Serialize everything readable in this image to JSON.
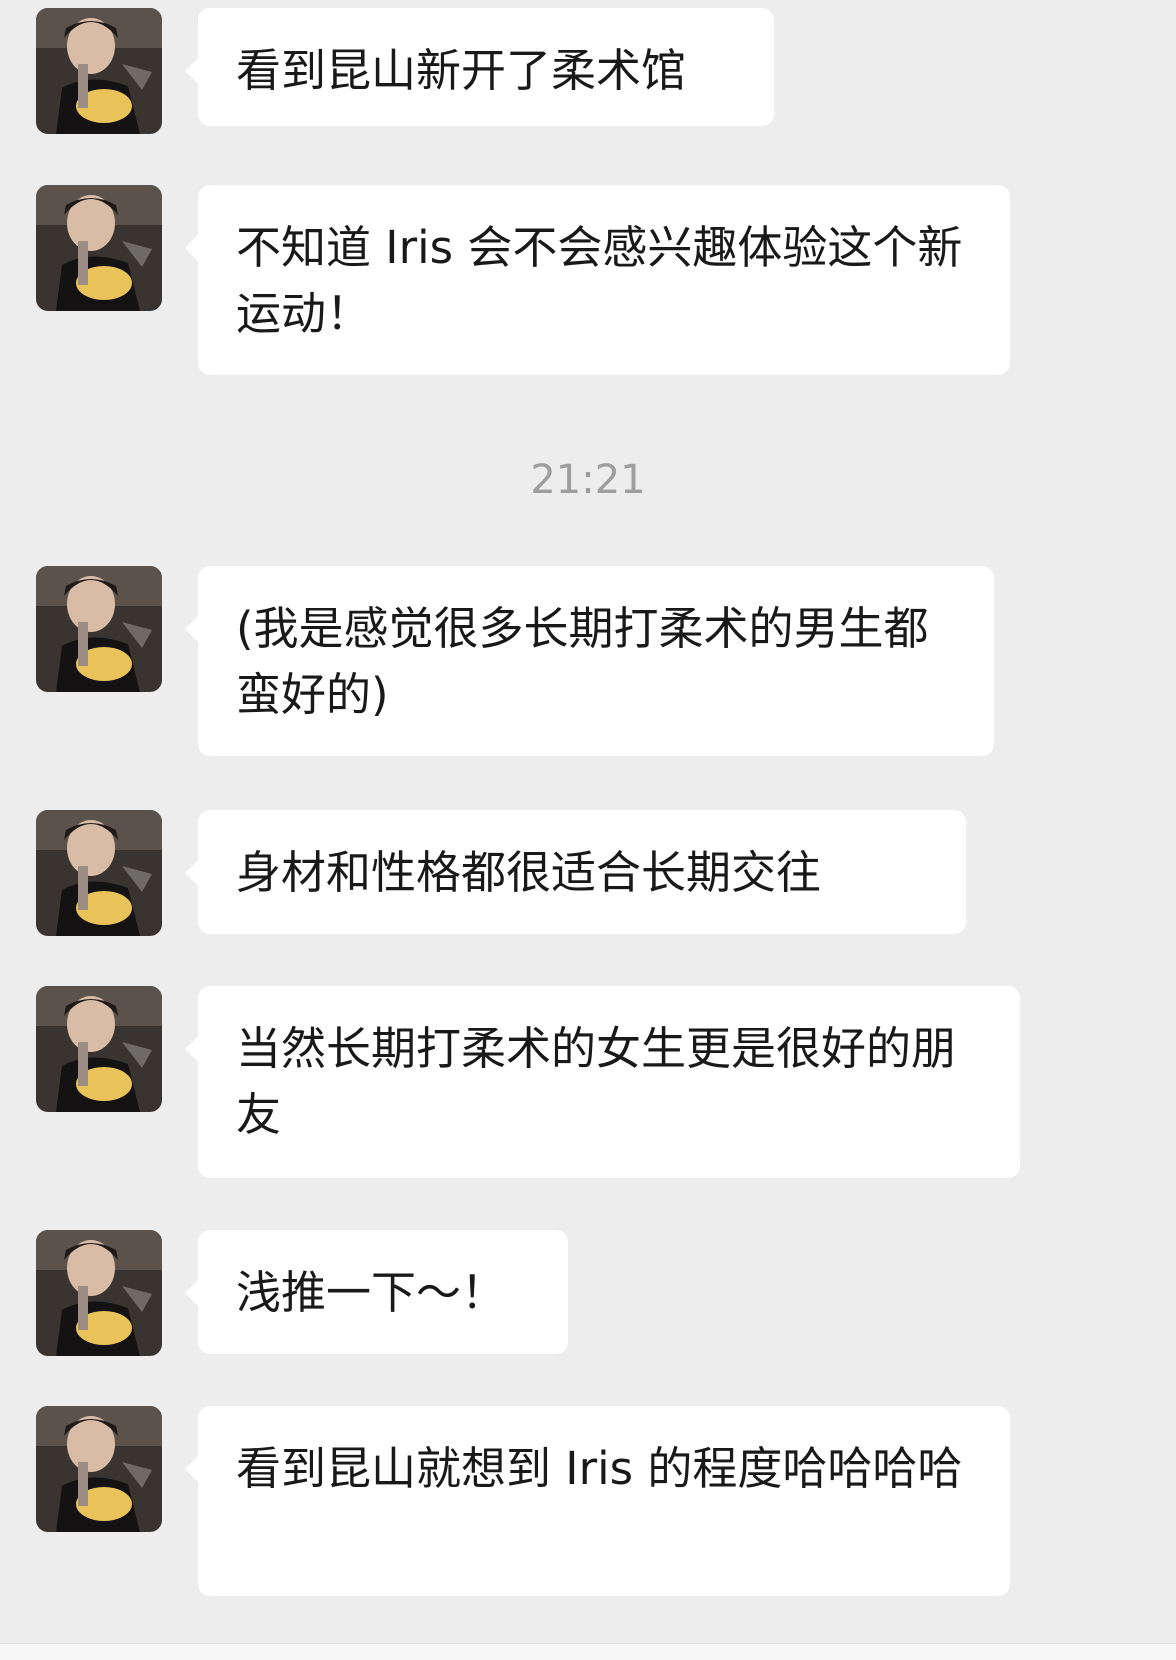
{
  "chat": {
    "avatar_icon": "contact-avatar-photo",
    "bubble_color": "#ffffff",
    "background_color": "#ededed",
    "time_separator": "21:21",
    "messages": [
      {
        "text": "看到昆山新开了柔术馆"
      },
      {
        "text": "不知道 Iris 会不会感兴趣体验这个新运动！"
      },
      {
        "text": "(我是感觉很多长期打柔术的男生都蛮好的)"
      },
      {
        "text": "身材和性格都很适合长期交往"
      },
      {
        "text": "当然长期打柔术的女生更是很好的朋友"
      },
      {
        "text": "浅推一下～！"
      },
      {
        "text": "看到昆山就想到 Iris 的程度哈哈哈哈"
      }
    ]
  }
}
